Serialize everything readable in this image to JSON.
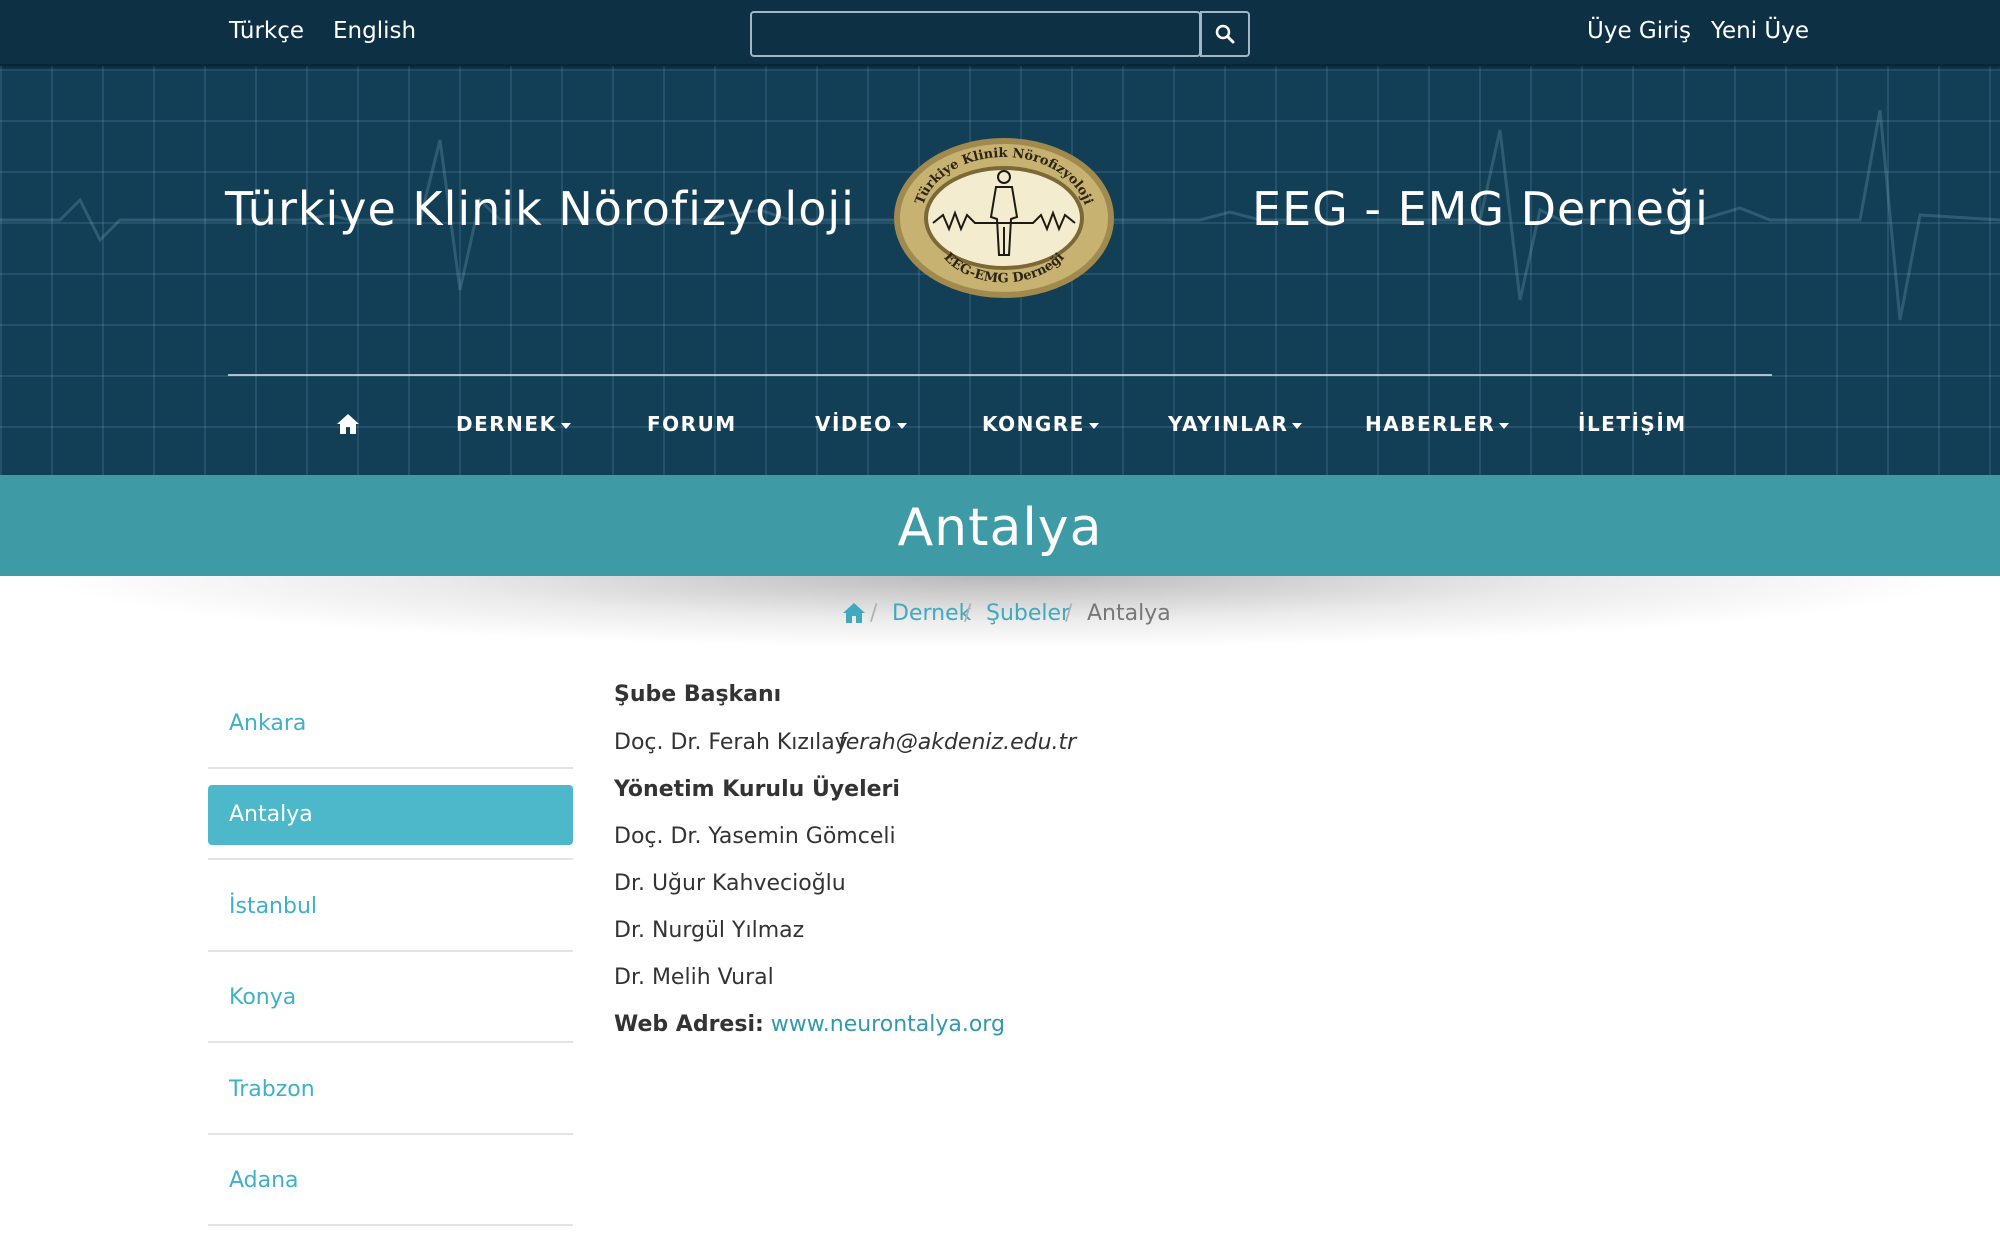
{
  "topbar": {
    "languages": [
      "Türkçe",
      "English"
    ],
    "search": {
      "value": "",
      "placeholder": ""
    },
    "search_icon": "search-icon",
    "auth": {
      "login": "Üye Giriş",
      "register": "Yeni Üye"
    }
  },
  "header": {
    "title_left": "Türkiye Klinik Nörofizyoloji",
    "title_right": "EEG - EMG Derneği",
    "logo": {
      "top_text": "Türkiye Klinik Nörofizyoloji",
      "bottom_text": "EEG-EMG Derneği"
    }
  },
  "nav": {
    "home_icon": "home-icon",
    "items": [
      {
        "label": "DERNEK",
        "dropdown": true
      },
      {
        "label": "FORUM",
        "dropdown": false
      },
      {
        "label": "VİDEO",
        "dropdown": true
      },
      {
        "label": "KONGRE",
        "dropdown": true
      },
      {
        "label": "YAYINLAR",
        "dropdown": true
      },
      {
        "label": "HABERLER",
        "dropdown": true
      },
      {
        "label": "İLETİŞİM",
        "dropdown": false
      }
    ]
  },
  "page": {
    "title": "Antalya",
    "breadcrumb": [
      "Dernek",
      "Şubeler",
      "Antalya"
    ]
  },
  "sidebar": {
    "items": [
      {
        "label": "Ankara",
        "active": false
      },
      {
        "label": "Antalya",
        "active": true
      },
      {
        "label": "İstanbul",
        "active": false
      },
      {
        "label": "Konya",
        "active": false
      },
      {
        "label": "Trabzon",
        "active": false
      },
      {
        "label": "Adana",
        "active": false
      }
    ]
  },
  "content": {
    "president_heading": "Şube Başkanı",
    "president_name": "Doç. Dr. Ferah Kızılay",
    "president_email": "ferah@akdeniz.edu.tr",
    "board_heading": "Yönetim Kurulu Üyeleri",
    "board_members": [
      "Doç. Dr. Yasemin Gömceli",
      "Dr. Uğur Kahvecioğlu",
      "Dr. Nurgül Yılmaz",
      "Dr. Melih Vural"
    ],
    "web_label": "Web Adresi:",
    "web_link": "www.neurontalya.org"
  },
  "colors": {
    "header_bg": "#123e56",
    "topbar_bg": "#0d3044",
    "band_bg": "#3e9aa5",
    "accent": "#4cb8c9",
    "link": "#3fa9c0"
  }
}
